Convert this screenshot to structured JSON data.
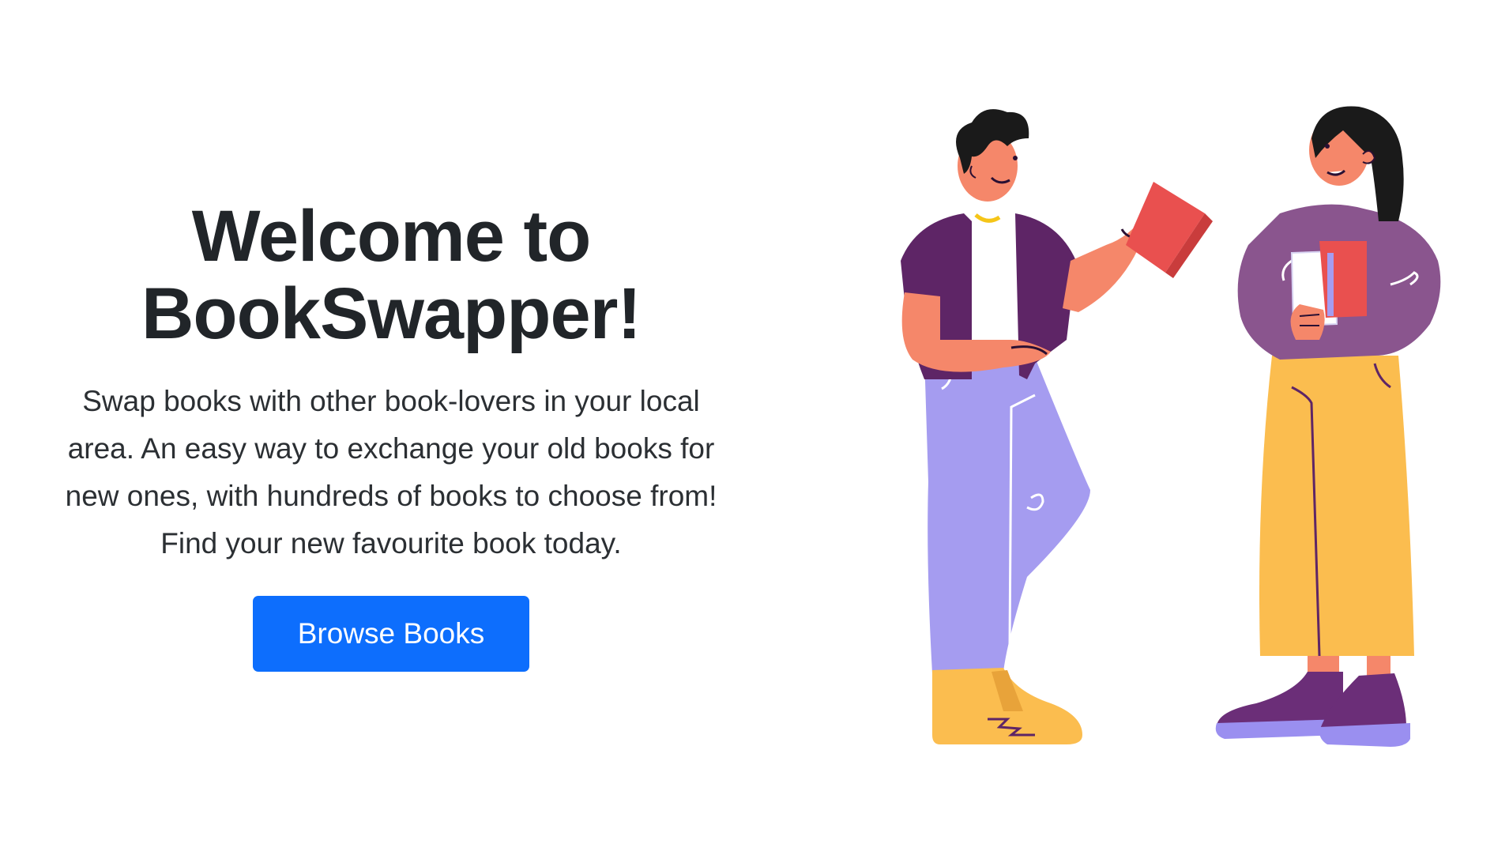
{
  "hero": {
    "title_line1": "Welcome to",
    "title_line2": "BookSwapper!",
    "lead": "Swap books with other book-lovers in your local area. An easy way to exchange your old books for new ones, with hundreds of books to choose from! Find your new favourite book today.",
    "button_label": "Browse Books"
  },
  "illustration": {
    "subject": "two-people-exchanging-books",
    "colors": {
      "skin": "#f5876a",
      "hair": "#1a1a1a",
      "vest": "#5e2566",
      "shirt_white": "#ffffff",
      "pants_lavender": "#a59cf0",
      "shoe_yellow": "#fbbd4f",
      "book_red": "#e9504f",
      "sweater_purple": "#8a558e",
      "skirt_yellow": "#fbbd4f",
      "shoe_purple": "#6b2e78",
      "sole_lavender": "#9a8ff0"
    }
  },
  "theme": {
    "primary": "#0d6efd",
    "text": "#212529"
  }
}
